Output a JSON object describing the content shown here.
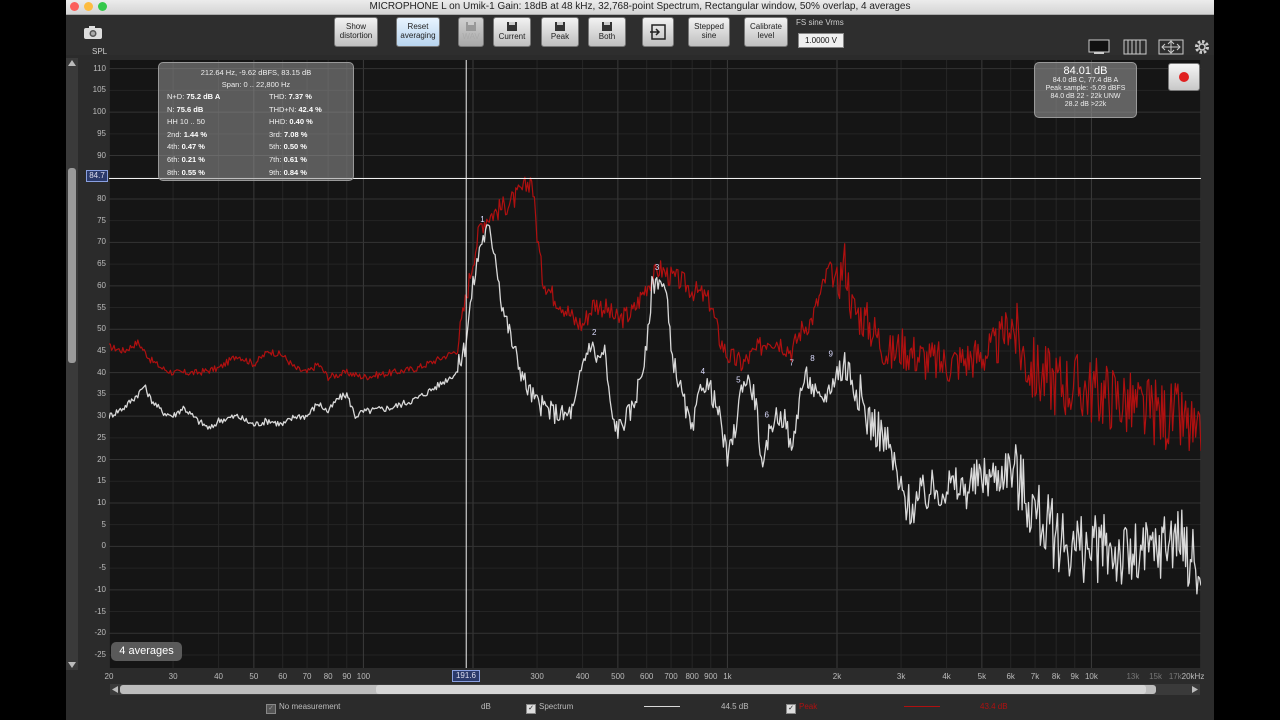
{
  "window": {
    "title": "MICROPHONE L on Umik-1  Gain: 18dB  at 48 kHz, 32,768-point Spectrum, Rectangular window, 50% overlap, 4 averages"
  },
  "toolbar": {
    "show_distortion": [
      "Show",
      "distortion"
    ],
    "reset_averaging": [
      "Reset",
      "averaging"
    ],
    "wav": "WAV",
    "current": "Current",
    "peak": "Peak",
    "both": "Both",
    "stepped_sine": [
      "Stepped",
      "sine"
    ],
    "calibrate_level": [
      "Calibrate",
      "level"
    ],
    "fs_label": "FS sine Vrms",
    "fs_value": "1.0000 V"
  },
  "spl_label": "SPL",
  "cursor": {
    "y_readout": "84.7",
    "x_readout": "191.6"
  },
  "info_panel": {
    "header": "212.64 Hz, -9.62 dBFS, 83.15 dB",
    "span": "Span: 0 .. 22,800 Hz",
    "rows": [
      {
        "l": "N+D:",
        "lv": "75.2 dB A",
        "r": "THD:",
        "rv": "7.37 %"
      },
      {
        "l": "N:",
        "lv": "75.6 dB",
        "r": "THD+N:",
        "rv": "42.4 %"
      },
      {
        "l": "HH 10 .. 50",
        "lv": "",
        "r": "HHD:",
        "rv": "0.40 %"
      },
      {
        "l": "2nd:",
        "lv": "1.44 %",
        "r": "3rd:",
        "rv": "7.08 %"
      },
      {
        "l": "4th:",
        "lv": "0.47 %",
        "r": "5th:",
        "rv": "0.50 %"
      },
      {
        "l": "6th:",
        "lv": "0.21 %",
        "r": "7th:",
        "rv": "0.61 %"
      },
      {
        "l": "8th:",
        "lv": "0.55 %",
        "r": "9th:",
        "rv": "0.84 %"
      }
    ]
  },
  "level_panel": {
    "value": "84.01 dB",
    "lines": [
      "84.0 dB C, 77.4 dB A",
      "Peak sample: -5.09 dBFS",
      "84.0 dB 22 - 22k UNW",
      "28.2 dB >22k"
    ]
  },
  "averages_badge": "4 averages",
  "legend": {
    "no_measurement": "No measurement",
    "db": "dB",
    "spectrum": "Spectrum",
    "spectrum_value": "44.5 dB",
    "peak": "Peak",
    "peak_value": "43.4 dB"
  },
  "colors": {
    "spectrum": "#d9d9d9",
    "peak": "#b01010",
    "background": "#151515"
  },
  "chart_data": {
    "type": "line",
    "xscale": "log",
    "xlim": [
      20,
      20000
    ],
    "ylim": [
      -28,
      112
    ],
    "y_ticks": [
      110,
      105,
      100,
      95,
      90,
      80,
      75,
      70,
      65,
      60,
      55,
      50,
      45,
      40,
      35,
      30,
      25,
      20,
      15,
      10,
      5,
      0,
      -5,
      -10,
      -15,
      -20,
      -25
    ],
    "x_ticks": [
      {
        "v": 20,
        "t": "20"
      },
      {
        "v": 30,
        "t": "30"
      },
      {
        "v": 40,
        "t": "40"
      },
      {
        "v": 50,
        "t": "50"
      },
      {
        "v": 60,
        "t": "60"
      },
      {
        "v": 70,
        "t": "70"
      },
      {
        "v": 80,
        "t": "80"
      },
      {
        "v": 90,
        "t": "90"
      },
      {
        "v": 100,
        "t": "100"
      },
      {
        "v": 300,
        "t": "300"
      },
      {
        "v": 400,
        "t": "400"
      },
      {
        "v": 500,
        "t": "500"
      },
      {
        "v": 600,
        "t": "600"
      },
      {
        "v": 700,
        "t": "700"
      },
      {
        "v": 800,
        "t": "800"
      },
      {
        "v": 900,
        "t": "900"
      },
      {
        "v": 1000,
        "t": "1k"
      },
      {
        "v": 2000,
        "t": "2k"
      },
      {
        "v": 3000,
        "t": "3k"
      },
      {
        "v": 4000,
        "t": "4k"
      },
      {
        "v": 5000,
        "t": "5k"
      },
      {
        "v": 6000,
        "t": "6k"
      },
      {
        "v": 7000,
        "t": "7k"
      },
      {
        "v": 8000,
        "t": "8k"
      },
      {
        "v": 9000,
        "t": "9k"
      },
      {
        "v": 10000,
        "t": "10k"
      },
      {
        "v": 13000,
        "t": "13k",
        "dim": true
      },
      {
        "v": 15000,
        "t": "15k",
        "dim": true
      },
      {
        "v": 17000,
        "t": "17k",
        "dim": true
      },
      {
        "v": 20000,
        "t": "20kHz"
      }
    ],
    "cursor": {
      "x": 191.6,
      "y": 84.7
    },
    "series": [
      {
        "name": "Peak",
        "color": "#b01010",
        "points": [
          [
            20,
            46
          ],
          [
            22,
            45
          ],
          [
            24,
            47
          ],
          [
            26,
            43
          ],
          [
            28,
            41
          ],
          [
            30,
            40
          ],
          [
            35,
            40
          ],
          [
            40,
            41
          ],
          [
            45,
            44
          ],
          [
            50,
            42
          ],
          [
            55,
            45
          ],
          [
            60,
            44
          ],
          [
            65,
            41
          ],
          [
            70,
            40
          ],
          [
            75,
            42
          ],
          [
            80,
            39
          ],
          [
            90,
            40
          ],
          [
            100,
            39
          ],
          [
            120,
            40
          ],
          [
            140,
            41
          ],
          [
            160,
            43
          ],
          [
            180,
            45
          ],
          [
            200,
            66
          ],
          [
            210,
            74
          ],
          [
            220,
            76
          ],
          [
            240,
            78
          ],
          [
            260,
            80
          ],
          [
            280,
            83
          ],
          [
            290,
            85
          ],
          [
            300,
            72
          ],
          [
            310,
            62
          ],
          [
            330,
            58
          ],
          [
            350,
            56
          ],
          [
            380,
            52
          ],
          [
            400,
            51
          ],
          [
            430,
            56
          ],
          [
            460,
            55
          ],
          [
            500,
            52
          ],
          [
            550,
            54
          ],
          [
            600,
            60
          ],
          [
            650,
            64
          ],
          [
            700,
            62
          ],
          [
            750,
            61
          ],
          [
            800,
            59
          ],
          [
            850,
            58
          ],
          [
            900,
            56
          ],
          [
            950,
            48
          ],
          [
            1000,
            44
          ],
          [
            1100,
            42
          ],
          [
            1200,
            45
          ],
          [
            1300,
            48
          ],
          [
            1400,
            47
          ],
          [
            1500,
            45
          ],
          [
            1600,
            50
          ],
          [
            1700,
            52
          ],
          [
            1800,
            58
          ],
          [
            1900,
            64
          ],
          [
            2000,
            60
          ],
          [
            2100,
            66
          ],
          [
            2200,
            55
          ],
          [
            2400,
            52
          ],
          [
            2600,
            48
          ],
          [
            2800,
            44
          ],
          [
            3000,
            46
          ],
          [
            3500,
            43
          ],
          [
            4000,
            42
          ],
          [
            4500,
            43
          ],
          [
            5000,
            44
          ],
          [
            5500,
            46
          ],
          [
            6000,
            52
          ],
          [
            6500,
            44
          ],
          [
            7000,
            40
          ],
          [
            8000,
            38
          ],
          [
            9000,
            37
          ],
          [
            10000,
            36
          ],
          [
            11000,
            35
          ],
          [
            12000,
            34
          ],
          [
            13000,
            32
          ],
          [
            14000,
            31
          ],
          [
            15000,
            31
          ],
          [
            16000,
            30
          ],
          [
            17000,
            30
          ],
          [
            18000,
            28
          ],
          [
            19000,
            26
          ],
          [
            20000,
            22
          ]
        ]
      },
      {
        "name": "Spectrum",
        "color": "#d9d9d9",
        "points": [
          [
            20,
            30
          ],
          [
            22,
            32
          ],
          [
            24,
            35
          ],
          [
            25,
            37
          ],
          [
            26,
            34
          ],
          [
            28,
            31
          ],
          [
            30,
            30
          ],
          [
            32,
            32
          ],
          [
            35,
            29
          ],
          [
            38,
            27
          ],
          [
            40,
            29
          ],
          [
            45,
            30
          ],
          [
            50,
            28
          ],
          [
            55,
            29
          ],
          [
            60,
            28
          ],
          [
            65,
            30
          ],
          [
            70,
            30
          ],
          [
            75,
            33
          ],
          [
            80,
            31
          ],
          [
            85,
            34
          ],
          [
            90,
            35
          ],
          [
            95,
            30
          ],
          [
            100,
            31
          ],
          [
            120,
            32
          ],
          [
            140,
            34
          ],
          [
            160,
            37
          ],
          [
            180,
            40
          ],
          [
            190,
            46
          ],
          [
            200,
            60
          ],
          [
            210,
            70
          ],
          [
            220,
            73
          ],
          [
            230,
            68
          ],
          [
            240,
            56
          ],
          [
            260,
            45
          ],
          [
            280,
            37
          ],
          [
            300,
            33
          ],
          [
            330,
            31
          ],
          [
            360,
            30
          ],
          [
            380,
            32
          ],
          [
            400,
            42
          ],
          [
            420,
            47
          ],
          [
            440,
            43
          ],
          [
            460,
            45
          ],
          [
            480,
            30
          ],
          [
            500,
            27
          ],
          [
            550,
            32
          ],
          [
            600,
            45
          ],
          [
            620,
            60
          ],
          [
            650,
            62
          ],
          [
            680,
            58
          ],
          [
            700,
            45
          ],
          [
            750,
            35
          ],
          [
            800,
            26
          ],
          [
            850,
            38
          ],
          [
            880,
            37
          ],
          [
            900,
            36
          ],
          [
            950,
            30
          ],
          [
            1000,
            20
          ],
          [
            1050,
            27
          ],
          [
            1100,
            38
          ],
          [
            1150,
            38
          ],
          [
            1200,
            33
          ],
          [
            1250,
            16
          ],
          [
            1300,
            26
          ],
          [
            1350,
            30
          ],
          [
            1400,
            30
          ],
          [
            1450,
            29
          ],
          [
            1500,
            21
          ],
          [
            1550,
            30
          ],
          [
            1600,
            37
          ],
          [
            1650,
            39
          ],
          [
            1700,
            37
          ],
          [
            1800,
            33
          ],
          [
            1900,
            36
          ],
          [
            2000,
            40
          ],
          [
            2100,
            42
          ],
          [
            2200,
            39
          ],
          [
            2300,
            36
          ],
          [
            2400,
            30
          ],
          [
            2600,
            27
          ],
          [
            2800,
            22
          ],
          [
            3000,
            12
          ],
          [
            3200,
            9
          ],
          [
            3500,
            12
          ],
          [
            4000,
            14
          ],
          [
            4500,
            13
          ],
          [
            5000,
            16
          ],
          [
            5500,
            16
          ],
          [
            6000,
            19
          ],
          [
            6500,
            13
          ],
          [
            7000,
            8
          ],
          [
            8000,
            2
          ],
          [
            9000,
            0
          ],
          [
            10000,
            -1
          ],
          [
            11000,
            0
          ],
          [
            12000,
            -2
          ],
          [
            13000,
            -3
          ],
          [
            14000,
            -2
          ],
          [
            15000,
            -1
          ],
          [
            16000,
            1
          ],
          [
            17000,
            3
          ],
          [
            18000,
            0
          ],
          [
            19000,
            -3
          ],
          [
            20000,
            -9
          ]
        ]
      }
    ],
    "harmonic_markers": [
      {
        "label": "1",
        "x": 212,
        "y": 74
      },
      {
        "label": "2",
        "x": 430,
        "y": 48
      },
      {
        "label": "3",
        "x": 640,
        "y": 63
      },
      {
        "label": "4",
        "x": 855,
        "y": 39
      },
      {
        "label": "5",
        "x": 1070,
        "y": 37
      },
      {
        "label": "6",
        "x": 1280,
        "y": 29
      },
      {
        "label": "7",
        "x": 1500,
        "y": 41
      },
      {
        "label": "8",
        "x": 1710,
        "y": 42
      },
      {
        "label": "9",
        "x": 1920,
        "y": 43
      }
    ]
  }
}
